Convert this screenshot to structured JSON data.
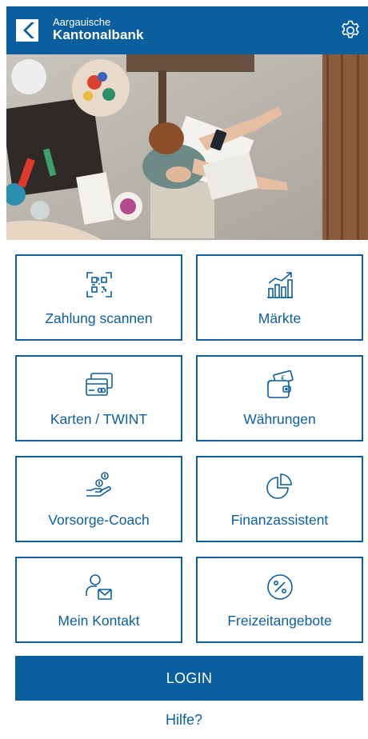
{
  "brand": {
    "line1": "Aargauische",
    "line2": "Kantonalbank",
    "color": "#0b5f9e"
  },
  "header": {
    "settings_icon": "gear-icon"
  },
  "hero": {
    "image": "hero-photo"
  },
  "tiles": [
    {
      "label": "Zahlung scannen",
      "icon": "qr-scan-icon"
    },
    {
      "label": "Märkte",
      "icon": "market-chart-icon"
    },
    {
      "label": "Karten / TWINT",
      "icon": "cards-icon"
    },
    {
      "label": "Währungen",
      "icon": "wallet-currency-icon"
    },
    {
      "label": "Vorsorge-Coach",
      "icon": "coins-hand-icon"
    },
    {
      "label": "Finanzassistent",
      "icon": "pie-chart-icon"
    },
    {
      "label": "Mein Kontakt",
      "icon": "contact-person-icon"
    },
    {
      "label": "Freizeitangebote",
      "icon": "percent-badge-icon"
    }
  ],
  "login": {
    "label": "LOGIN"
  },
  "help": {
    "label": "Hilfe?"
  }
}
